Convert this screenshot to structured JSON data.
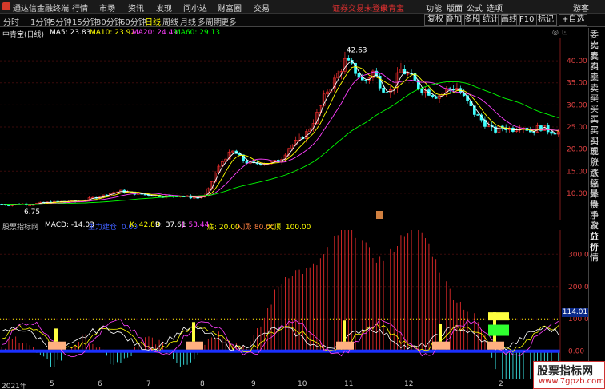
{
  "menubar": {
    "app_title": "通达信金融终端",
    "menus": [
      "行情",
      "市场",
      "资讯",
      "发现",
      "问小达",
      "财富圈",
      "交易"
    ],
    "warning": "证券交易未登录",
    "stock_name": "中青宝",
    "right": [
      "功能",
      "版面",
      "公式",
      "选项",
      "游客"
    ]
  },
  "toolbar": {
    "periods": [
      "分时",
      "1分钟",
      "5分钟",
      "15分钟",
      "30分钟",
      "60分钟",
      "日线",
      "周线",
      "月线",
      "多周期",
      "更多"
    ],
    "active_period": "日线",
    "buttons": [
      "复权",
      "叠加",
      "多股",
      "统计",
      "画线",
      "F10",
      "标记",
      "+自选"
    ]
  },
  "main_header": {
    "title": "中青宝(日线)",
    "ma5": "MA5: 23.83",
    "ma10": "MA10: 23.92",
    "ma20": "MA20: 24.49",
    "ma60": "MA60: 29.13",
    "colors": {
      "ma5": "#ffffff",
      "ma10": "#ffff00",
      "ma20": "#ff40ff",
      "ma60": "#00ff00"
    }
  },
  "price_axis": [
    "40.00",
    "35.00",
    "30.00",
    "25.00",
    "20.00",
    "15.00",
    "10.00"
  ],
  "annotations": {
    "high": "42.63",
    "low": "6.75"
  },
  "indicator_header": {
    "name": "股票指标网",
    "macd": "MACD: -14.03",
    "main_force": "主力建仓: 0.00",
    "k": "K: 42.89",
    "d": "D: 37.61",
    "j": "J: 53.44",
    "bottom": "底: 20.00",
    "entry": "入顶: 80.00",
    "top": "大顶: 100.00"
  },
  "indicator_axis": [
    "300.0",
    "200.0",
    "100.0",
    "0.00"
  ],
  "indicator_tag": "114.01",
  "date_axis": [
    "2021年",
    "5",
    "6",
    "7",
    "8",
    "9",
    "10",
    "11",
    "12",
    "2"
  ],
  "right_panel": [
    "委比",
    "卖五",
    "卖四",
    "卖三",
    "卖二",
    "卖一",
    "买一",
    "买二",
    "买三",
    "买四",
    "买五",
    "现价",
    "涨跌",
    "涨幅",
    "总量",
    "外盘",
    "换手",
    "净资",
    "收益",
    "分价",
    "行情"
  ],
  "watermark": {
    "line1": "股票指标网",
    "line2": "www.7gpzb.com"
  },
  "chart_data": {
    "type": "candlestick",
    "title": "中青宝(日线)",
    "price_ylim": [
      6,
      44
    ],
    "close_series": [
      7.5,
      7.4,
      7.6,
      7.5,
      7.7,
      7.9,
      8.0,
      8.2,
      8.1,
      8.5,
      9.0,
      9.5,
      10.2,
      10.5,
      10.1,
      9.8,
      9.6,
      9.4,
      9.3,
      9.5,
      9.2,
      9.0,
      9.4,
      14.5,
      18.0,
      19.5,
      17.5,
      16.5,
      17.0,
      16.8,
      17.5,
      20.5,
      22.0,
      24.0,
      28.0,
      33.0,
      36.0,
      40.0,
      38.0,
      35.0,
      37.5,
      34.0,
      33.0,
      38.0,
      36.5,
      34.0,
      33.0,
      32.0,
      33.5,
      34.0,
      31.0,
      28.0,
      26.0,
      24.0,
      25.0,
      24.5,
      25.5,
      24.0,
      25.0,
      24.2,
      23.8
    ],
    "ma60_end": 29.13,
    "indicator_ylim": [
      -60,
      360
    ]
  }
}
